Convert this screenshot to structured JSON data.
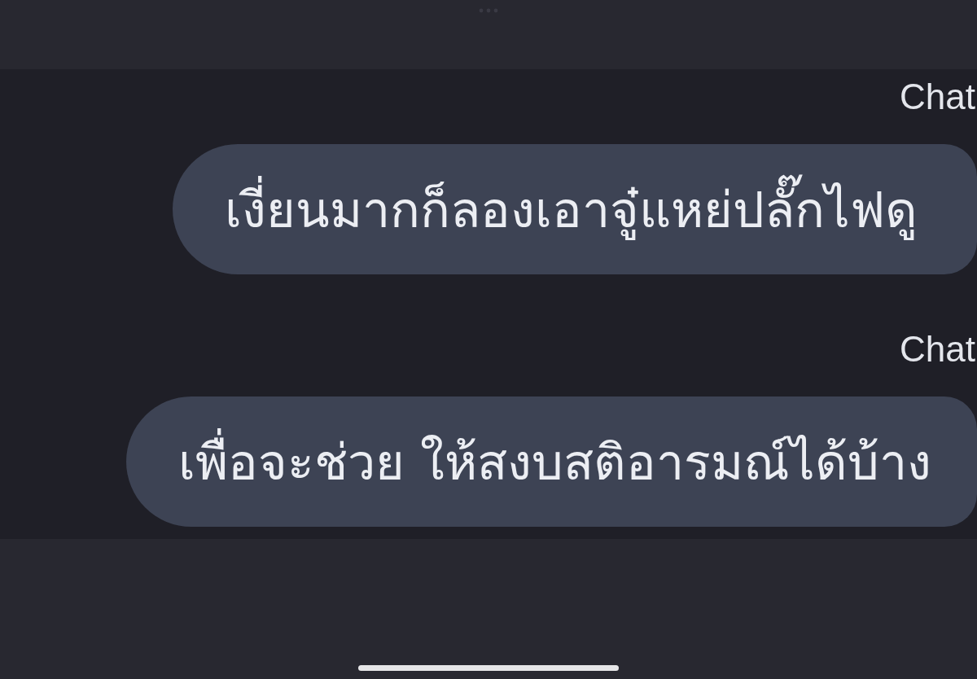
{
  "chat": [
    {
      "label": "Chat",
      "message": "เงี่ยนมากก็ลองเอาจู๋แหย่ปลั๊กไฟดู"
    },
    {
      "label": "Chat",
      "message": "เพื่อจะช่วย ให้สงบสติอารมณ์ได้บ้าง"
    }
  ]
}
